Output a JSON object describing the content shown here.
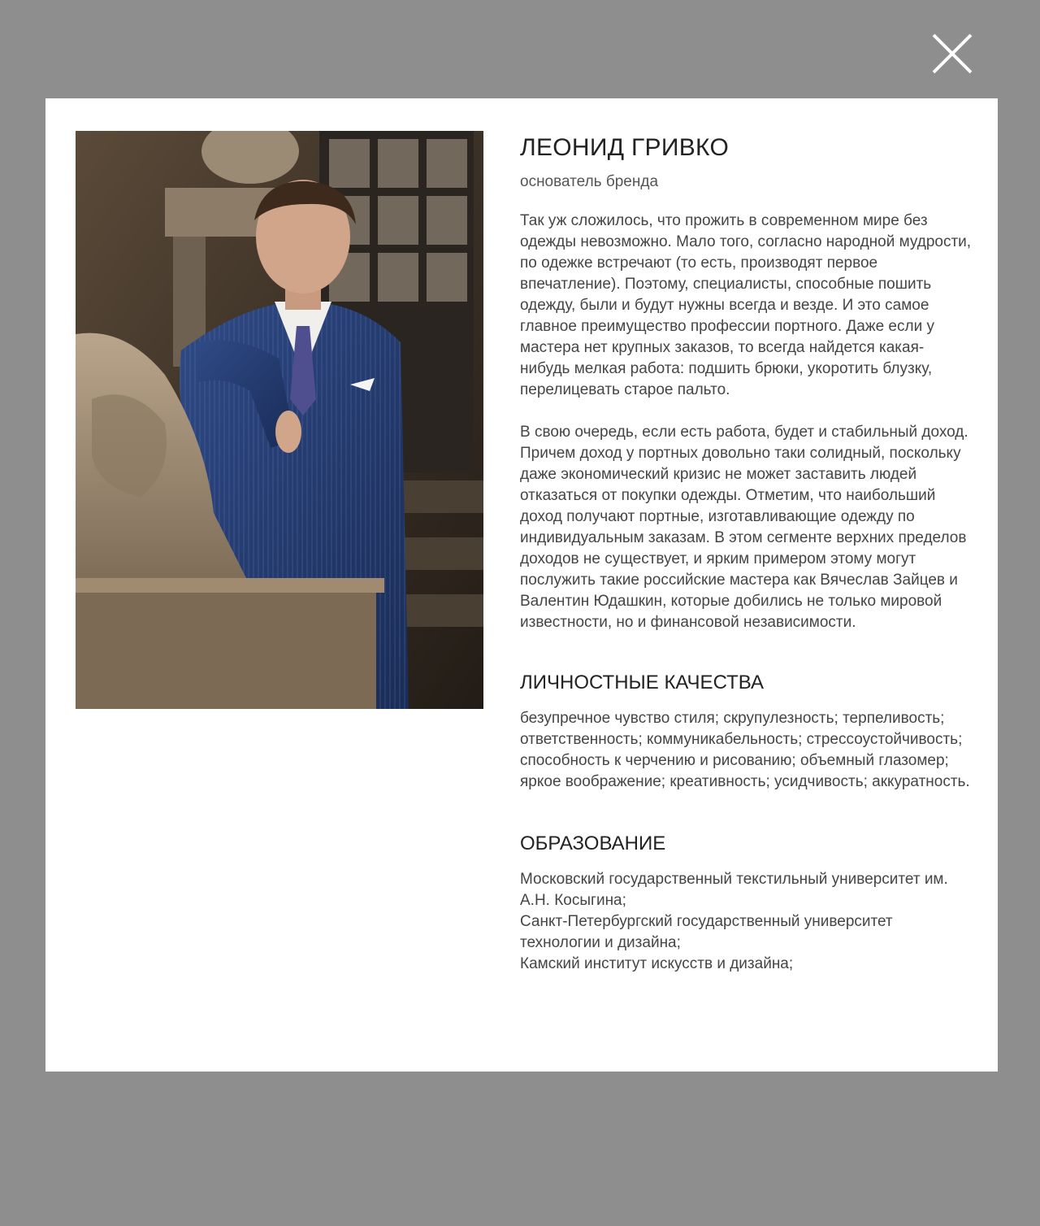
{
  "close": {
    "icon": "close-icon"
  },
  "profile": {
    "name": "ЛЕОНИД ГРИВКО",
    "role": "основатель бренда",
    "photo_icon": "portrait-photo",
    "paragraphs": [
      "Так уж сложилось, что прожить в современном мире без одежды невозможно. Мало того, согласно народной мудрости, по одежке встречают (то есть, производят первое впечатление). Поэтому, специалисты, способные пошить одежду, были и будут нужны всегда и везде. И это самое главное преимущество профессии портного. Даже если у мастера нет крупных заказов, то всегда найдется какая-нибудь мелкая работа: подшить брюки, укоротить блузку, перелицевать старое пальто.",
      "В свою очередь, если есть работа, будет и стабильный доход. Причем доход у портных довольно таки солидный, поскольку даже экономический кризис не может заставить людей отказаться от покупки одежды. Отметим, что наибольший доход получают портные, изготавливающие одежду по индивидуальным заказам. В этом сегменте верхних пределов доходов не существует, и ярким примером этому могут послужить такие российские мастера как Вячеслав Зайцев и Валентин Юдашкин, которые добились не только мировой известности, но и финансовой независимости."
    ]
  },
  "qualities": {
    "title": "ЛИЧНОСТНЫЕ КАЧЕСТВА",
    "text": "безупречное чувство стиля; скрупулезность; терпеливость; ответственность; коммуникабельность; стрессоустойчивость; способность к черчению и рисованию; объемный глазомер; яркое воображение; креативность; усидчивость; аккуратность."
  },
  "education": {
    "title": "ОБРАЗОВАНИЕ",
    "items": [
      "Московский государственный текстильный университет им. А.Н. Косыгина;",
      "Санкт-Петербургский государственный университет технологии и дизайна;",
      "Камский институт искусств и дизайна;"
    ]
  },
  "colors": {
    "overlay": "#8e8e8e",
    "modal": "#ffffff",
    "heading": "#222222",
    "text": "#454545"
  }
}
